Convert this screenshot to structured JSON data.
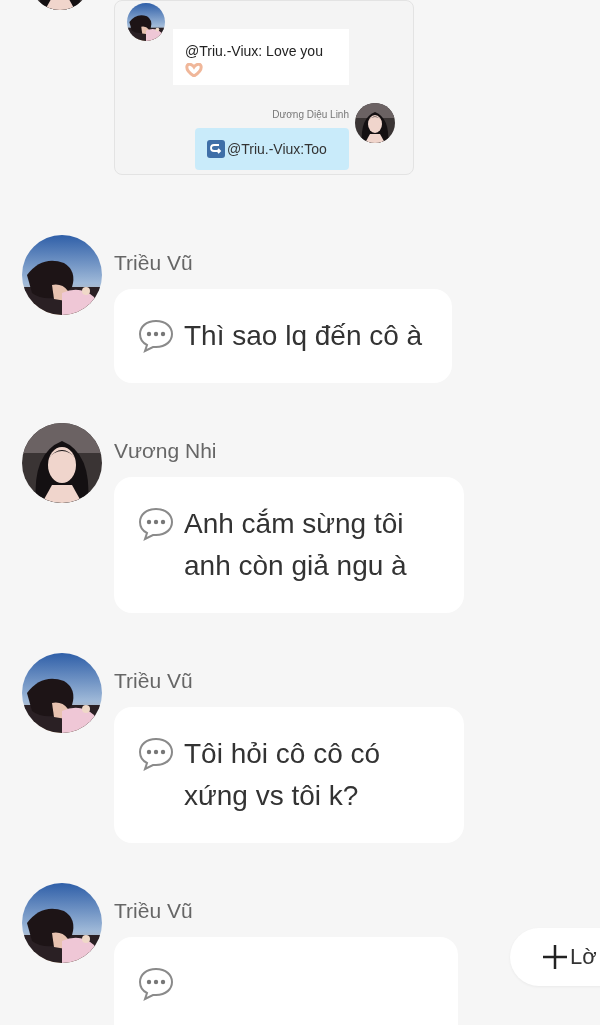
{
  "quoted_card": {
    "messages": [
      {
        "kind": "incoming",
        "text": "@Triu.-Viux: Love you"
      },
      {
        "kind": "outgoing",
        "sender": "Dương Diệu Linh",
        "text": "@Triu.-Viux:Too"
      }
    ]
  },
  "messages": [
    {
      "sender": "Triều Vũ",
      "text": "Thì sao lq đến cô à"
    },
    {
      "sender": "Vương Nhi",
      "text": "Anh cắm sừng tôi anh còn giả ngu à"
    },
    {
      "sender": "Triều Vũ",
      "text": "Tôi hỏi cô cô có xứng vs tôi k?"
    },
    {
      "sender": "Triều Vũ"
    }
  ],
  "floating_button": {
    "label": "Lờ"
  }
}
